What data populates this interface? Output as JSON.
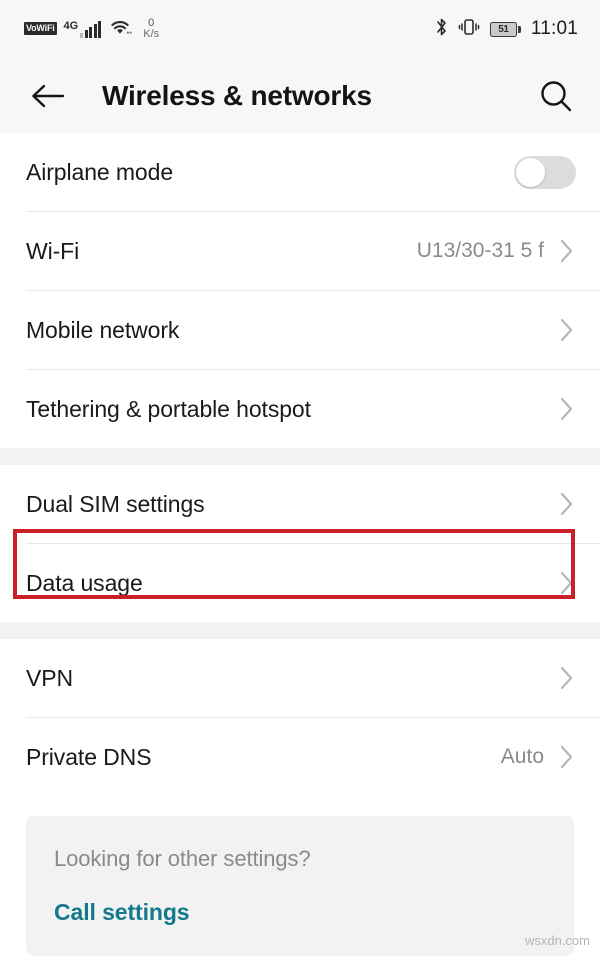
{
  "status_bar": {
    "vowifi_badge": "VoWiFi",
    "network_type": "4G",
    "data_rate_value": "0",
    "data_rate_unit": "K/s",
    "bluetooth_icon": "bluetooth-icon",
    "vibrate_icon": "vibrate-icon",
    "battery_level": "51",
    "time": "11:01"
  },
  "app_bar": {
    "back_icon": "back-arrow-icon",
    "title": "Wireless & networks",
    "search_icon": "search-icon"
  },
  "sections": [
    {
      "rows": [
        {
          "label": "Airplane mode",
          "control": "toggle",
          "toggle_on": false
        },
        {
          "label": "Wi-Fi",
          "value": "U13/30-31 5 f",
          "control": "chevron"
        },
        {
          "label": "Mobile network",
          "value": "",
          "control": "chevron"
        },
        {
          "label": "Tethering & portable hotspot",
          "value": "",
          "control": "chevron"
        }
      ]
    },
    {
      "rows": [
        {
          "label": "Dual SIM settings",
          "value": "",
          "control": "chevron"
        },
        {
          "label": "Data usage",
          "value": "",
          "control": "chevron",
          "highlighted": true
        }
      ]
    },
    {
      "rows": [
        {
          "label": "VPN",
          "value": "",
          "control": "chevron"
        },
        {
          "label": "Private DNS",
          "value": "Auto",
          "control": "chevron"
        }
      ]
    }
  ],
  "footer": {
    "question": "Looking for other settings?",
    "link": "Call settings"
  },
  "watermark": "wsxdn.com",
  "colors": {
    "highlight": "#cc1f2a",
    "link": "#14788d",
    "section_gap": "#f2f2f2",
    "bar_background": "#f7f7f7"
  }
}
